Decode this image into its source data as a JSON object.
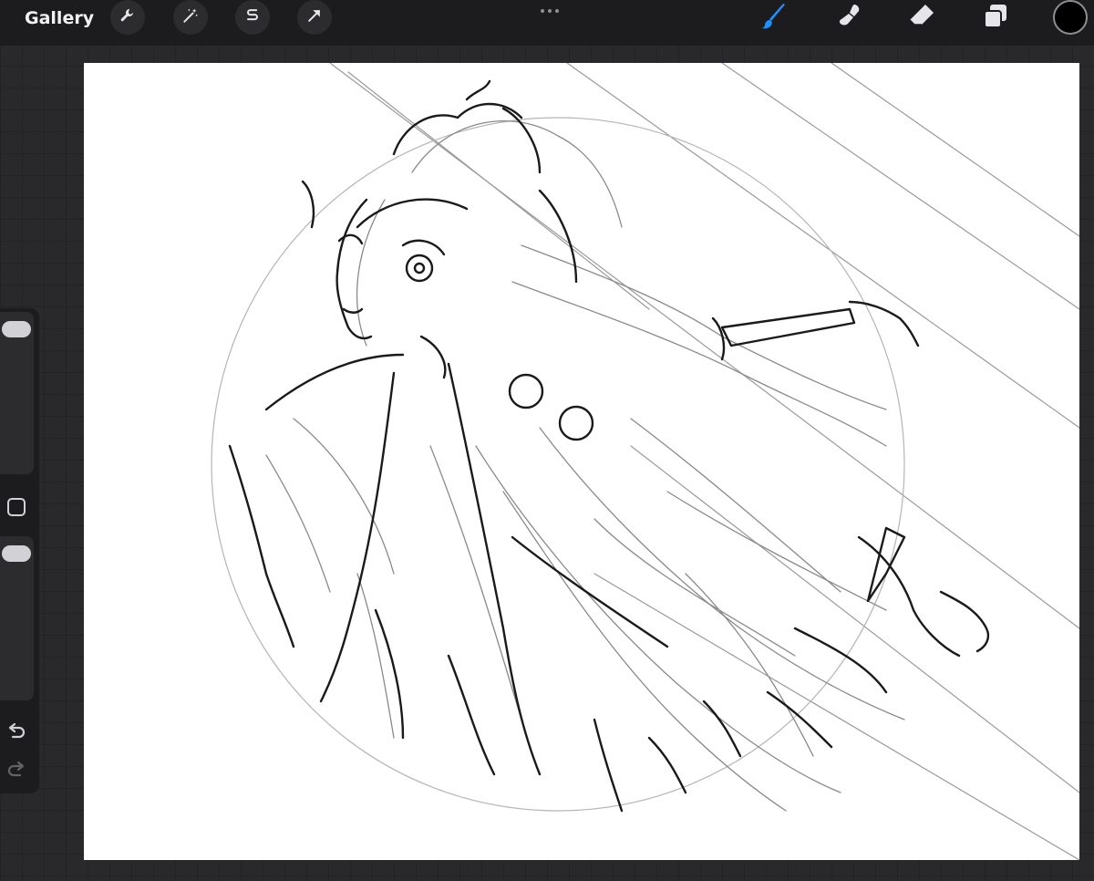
{
  "toolbar": {
    "gallery_label": "Gallery",
    "left_tools": [
      {
        "name": "actions",
        "icon": "wrench-icon"
      },
      {
        "name": "adjustments",
        "icon": "magic-wand-icon"
      },
      {
        "name": "selection",
        "icon": "selection-s-icon"
      },
      {
        "name": "transform",
        "icon": "arrow-cursor-icon"
      }
    ],
    "right_tools": [
      {
        "name": "brush",
        "icon": "brush-icon",
        "active": true
      },
      {
        "name": "smudge",
        "icon": "smudge-icon",
        "active": false
      },
      {
        "name": "eraser",
        "icon": "eraser-icon",
        "active": false
      },
      {
        "name": "layers",
        "icon": "layers-icon",
        "active": false
      }
    ],
    "current_color": "#000000"
  },
  "sidebar": {
    "brush_size_level": 0.95,
    "brush_opacity_level": 0.95,
    "modify_icon": "square-icon",
    "undo_icon": "undo-icon",
    "redo_icon": "redo-icon"
  },
  "colors": {
    "accent": "#1e90ff",
    "toolbar_bg": "#1c1c1e",
    "canvas_bg": "#ffffff"
  }
}
